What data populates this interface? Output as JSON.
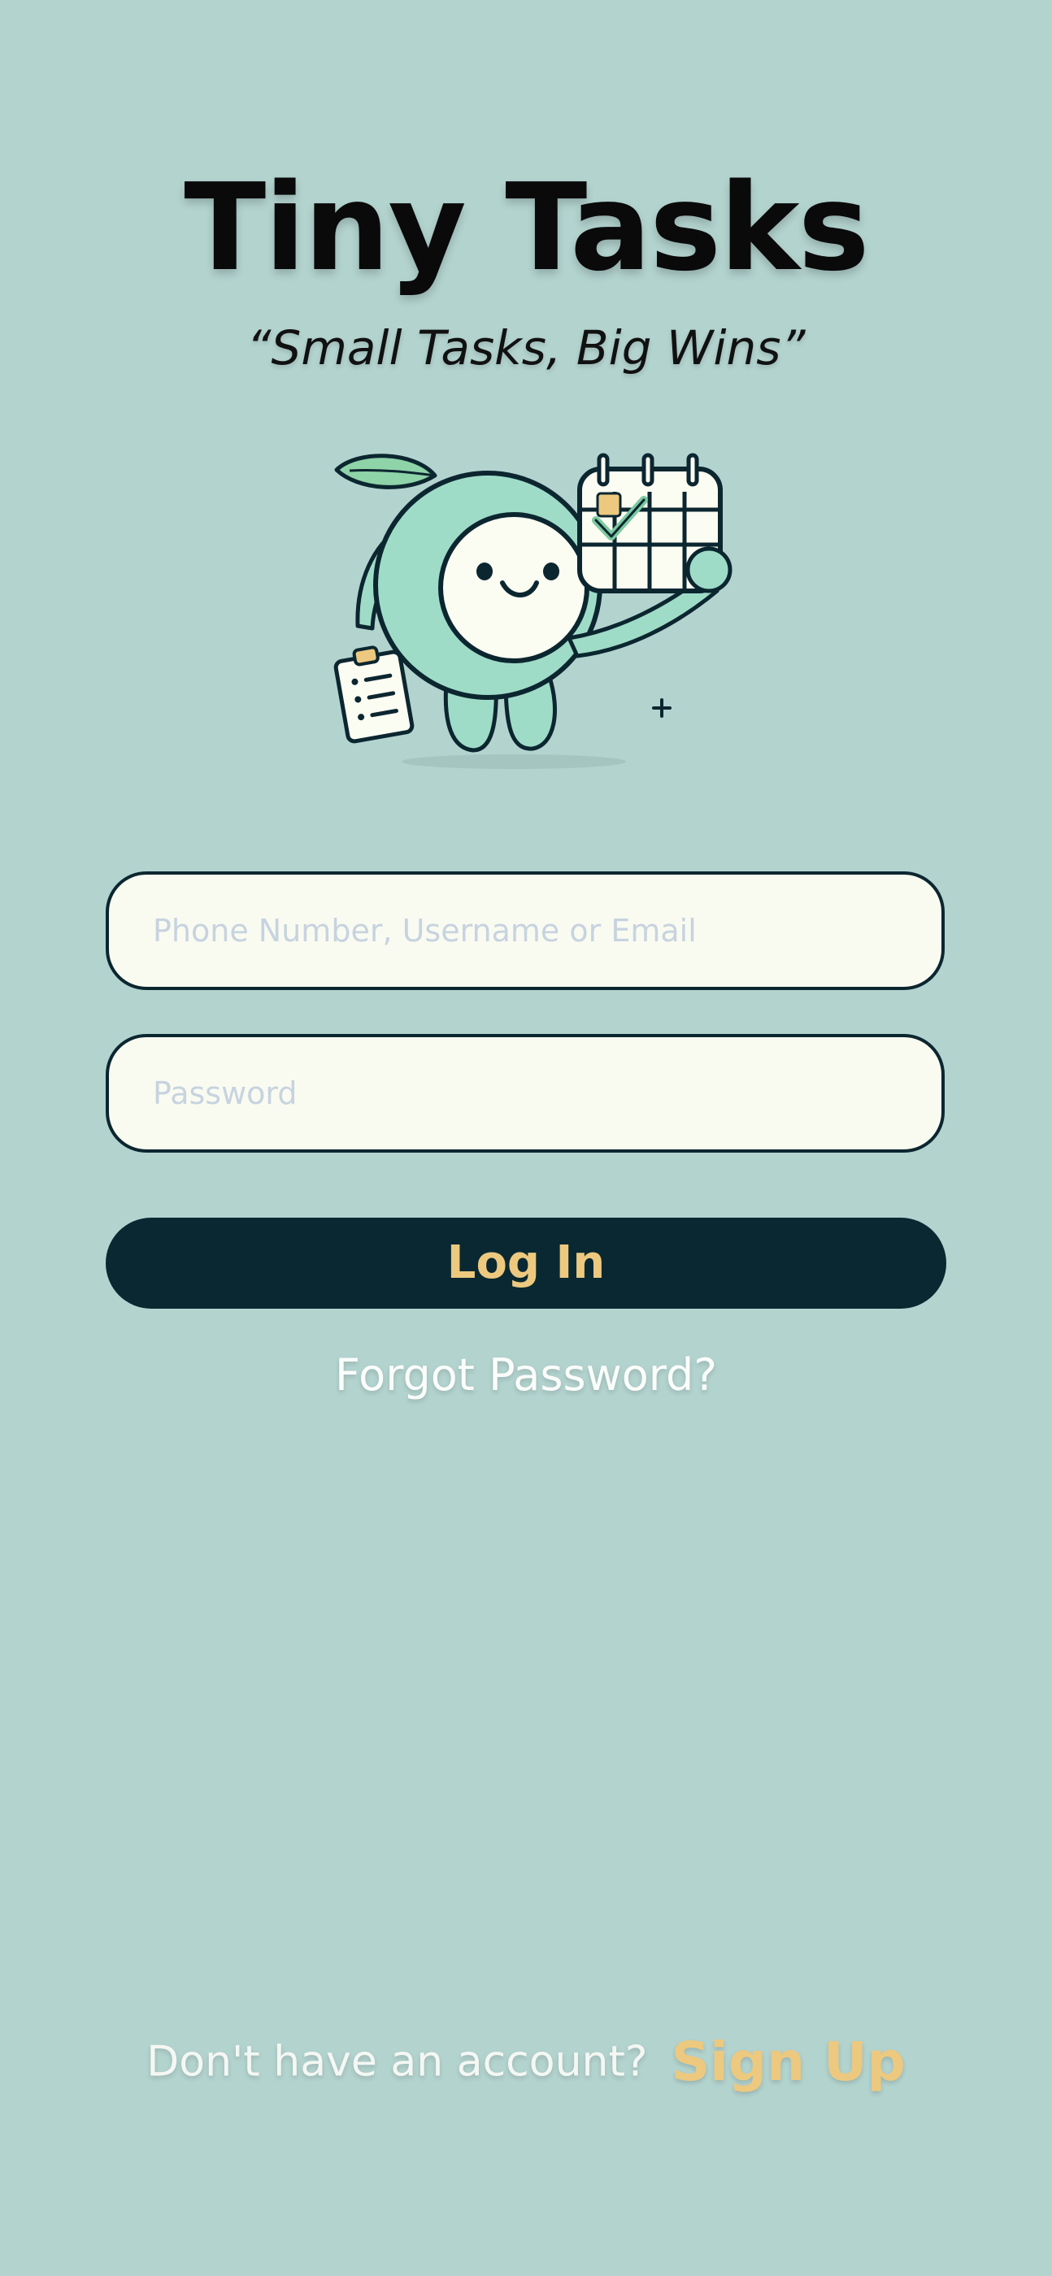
{
  "app": {
    "title": "Tiny Tasks",
    "tagline": "“Small Tasks, Big Wins”"
  },
  "login_form": {
    "username_placeholder": "Phone Number, Username or Email",
    "password_placeholder": "Password",
    "login_button_label": "Log In",
    "forgot_password_label": "Forgot Password?"
  },
  "signup": {
    "prompt": "Don't have an account?",
    "link_label": "Sign Up"
  },
  "mascot": {
    "icon": "mascot-with-calendar-icon"
  },
  "colors": {
    "background": "#b3d3cf",
    "input_background": "#f9fbf1",
    "input_border": "#0c2630",
    "button_background": "#0a2831",
    "accent": "#ecc97f",
    "mascot_body": "#9fdcc8"
  }
}
